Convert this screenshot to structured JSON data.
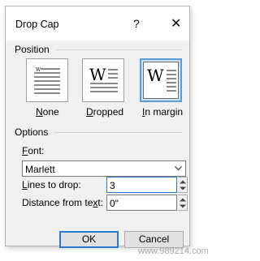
{
  "dialog": {
    "title": "Drop Cap",
    "help": "?",
    "close": "✕"
  },
  "position": {
    "section_label": "Position",
    "options": [
      {
        "label": "None",
        "mnemonic": "N",
        "rest": "one",
        "selected": false
      },
      {
        "label": "Dropped",
        "mnemonic": "D",
        "rest": "ropped",
        "selected": false
      },
      {
        "label": "In margin",
        "mnemonic": "I",
        "rest": "n margin",
        "selected": true
      }
    ],
    "preview_letter": "W"
  },
  "options": {
    "section_label": "Options",
    "font": {
      "label_mnemonic": "F",
      "label_rest": "ont:",
      "value": "Marlett"
    },
    "lines_to_drop": {
      "label_mnemonic": "L",
      "label_rest": "ines to drop:",
      "value": "3"
    },
    "distance_from_text": {
      "label_pre": "Distance from te",
      "label_mnemonic": "x",
      "label_post": "t:",
      "value": "0\""
    }
  },
  "buttons": {
    "ok": "OK",
    "cancel": "Cancel"
  },
  "watermark": "www.989214.com",
  "colors": {
    "dialog_bg": "#f0f0f0",
    "selected_border": "#5a9bd4",
    "focus_border": "#2d78d2"
  }
}
